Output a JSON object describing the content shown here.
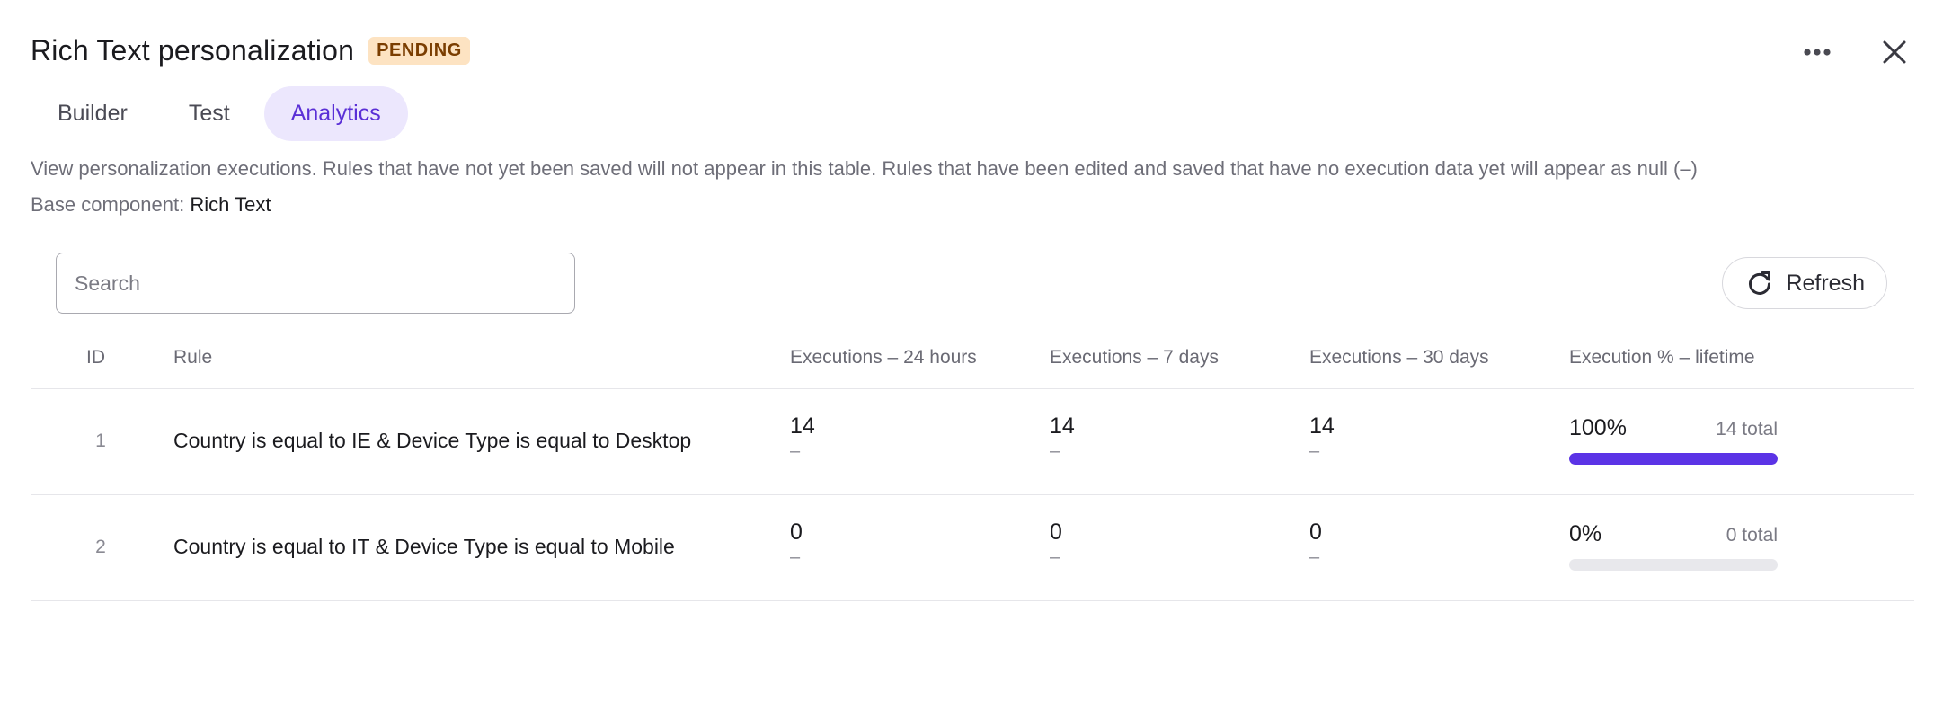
{
  "header": {
    "title": "Rich Text personalization",
    "badge": "PENDING",
    "more_icon": "more-horizontal-icon",
    "close_icon": "close-icon"
  },
  "tabs": [
    {
      "label": "Builder",
      "active": false
    },
    {
      "label": "Test",
      "active": false
    },
    {
      "label": "Analytics",
      "active": true
    }
  ],
  "description": "View personalization executions. Rules that have not yet been saved will not appear in this table. Rules that have been edited and saved that have no execution data yet will appear as null (–)",
  "base_component": {
    "label": "Base component:",
    "value": "Rich Text"
  },
  "search": {
    "placeholder": "Search",
    "value": ""
  },
  "refresh": {
    "label": "Refresh",
    "icon": "refresh-icon"
  },
  "table": {
    "columns": [
      "ID",
      "Rule",
      "Executions – 24 hours",
      "Executions – 7 days",
      "Executions – 30 days",
      "Execution % – lifetime"
    ],
    "rows": [
      {
        "id": "1",
        "rule": "Country is equal to IE & Device Type is equal to Desktop",
        "exec_24h": "14",
        "exec_24h_sub": "–",
        "exec_7d": "14",
        "exec_7d_sub": "–",
        "exec_30d": "14",
        "exec_30d_sub": "–",
        "lifetime_pct": "100%",
        "lifetime_total": "14 total",
        "lifetime_fraction": 1.0
      },
      {
        "id": "2",
        "rule": "Country is equal to IT & Device Type is equal to Mobile",
        "exec_24h": "0",
        "exec_24h_sub": "–",
        "exec_7d": "0",
        "exec_7d_sub": "–",
        "exec_30d": "0",
        "exec_30d_sub": "–",
        "lifetime_pct": "0%",
        "lifetime_total": "0 total",
        "lifetime_fraction": 0.0
      }
    ]
  },
  "colors": {
    "accent": "#5b33e6",
    "badge_bg": "#fde3c2",
    "tab_active_bg": "#ece7fd"
  }
}
